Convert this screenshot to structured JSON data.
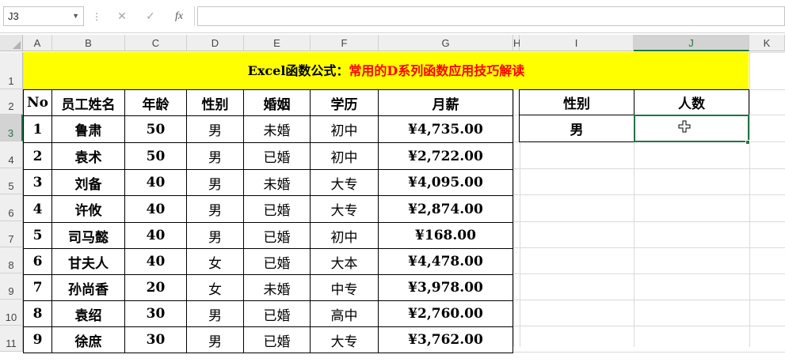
{
  "name_box": {
    "value": "J3"
  },
  "formula_bar": {
    "cancel_icon": "✕",
    "enter_icon": "✓",
    "fx_label": "fx",
    "formula": ""
  },
  "columns": [
    "A",
    "B",
    "C",
    "D",
    "E",
    "F",
    "G",
    "H",
    "I",
    "J",
    "K"
  ],
  "selected_column": "J",
  "rows": [
    "1",
    "2",
    "3",
    "4",
    "5",
    "6",
    "7",
    "8",
    "9",
    "10",
    "11"
  ],
  "selected_row": "3",
  "title": {
    "part1": "Excel函数公式：",
    "part2": "常用的D系列函数应用技巧解读"
  },
  "table": {
    "headers": [
      "No",
      "员工姓名",
      "年龄",
      "性别",
      "婚姻",
      "学历",
      "月薪"
    ],
    "rows": [
      [
        "1",
        "鲁肃",
        "50",
        "男",
        "未婚",
        "初中",
        "¥4,735.00"
      ],
      [
        "2",
        "袁术",
        "50",
        "男",
        "已婚",
        "初中",
        "¥2,722.00"
      ],
      [
        "3",
        "刘备",
        "40",
        "男",
        "未婚",
        "大专",
        "¥4,095.00"
      ],
      [
        "4",
        "许攸",
        "40",
        "男",
        "已婚",
        "大专",
        "¥2,874.00"
      ],
      [
        "5",
        "司马懿",
        "40",
        "男",
        "已婚",
        "初中",
        "¥168.00"
      ],
      [
        "6",
        "甘夫人",
        "40",
        "女",
        "已婚",
        "大本",
        "¥4,478.00"
      ],
      [
        "7",
        "孙尚香",
        "20",
        "女",
        "未婚",
        "中专",
        "¥3,978.00"
      ],
      [
        "8",
        "袁绍",
        "30",
        "男",
        "已婚",
        "高中",
        "¥2,760.00"
      ],
      [
        "9",
        "徐庶",
        "30",
        "男",
        "已婚",
        "大专",
        "¥3,762.00"
      ]
    ]
  },
  "criteria": {
    "headers": [
      "性别",
      "人数"
    ],
    "values": [
      "男",
      ""
    ]
  },
  "colors": {
    "title_bg": "#ffff00",
    "title_accent": "#ff0000",
    "selection": "#217346"
  }
}
